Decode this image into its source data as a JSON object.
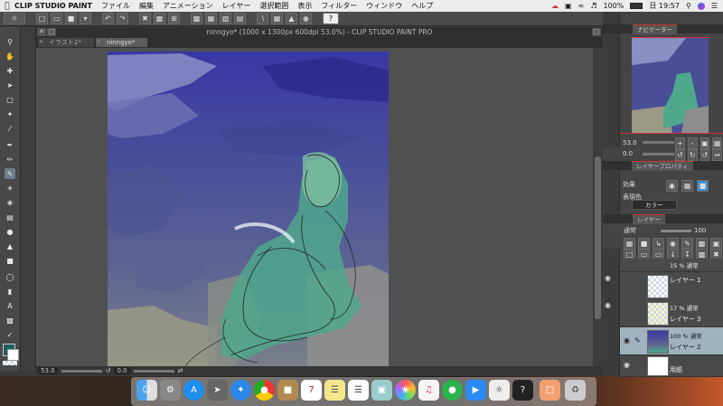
{
  "menubar": {
    "app_name": "CLIP STUDIO PAINT",
    "items": [
      "ファイル",
      "編集",
      "アニメーション",
      "レイヤー",
      "選択範囲",
      "表示",
      "フィルター",
      "ウィンドウ",
      "ヘルプ"
    ],
    "battery": "100%",
    "clock": "日 19:57"
  },
  "window": {
    "title": "ninngyo* (1000 x 1300px 600dpi 53.0%)  - CLIP STUDIO PAINT PRO",
    "tabs": [
      {
        "label": "イラスト2*"
      },
      {
        "label": "ninngyo*"
      }
    ]
  },
  "statusbar": {
    "zoom": "53.0",
    "angle": "0.0"
  },
  "navigator": {
    "tab_label": "ナビゲーター",
    "zoom": "53.0",
    "angle": "0.0"
  },
  "layer_property": {
    "tab_label": "レイヤープロパティ",
    "effect_label": "効果",
    "expression_label": "表現色",
    "expression_value": "カラー"
  },
  "layers_panel": {
    "tab_label": "レイヤー",
    "blend_mode": "通常",
    "opacity": "100",
    "layers": [
      {
        "opacity": "15 % 通常",
        "name": "レイヤー 1"
      },
      {
        "opacity": "17 % 通常",
        "name": "レイヤー 3"
      },
      {
        "opacity": "100 % 通常",
        "name": "レイヤー 2"
      },
      {
        "opacity": "",
        "name": "用紙"
      }
    ]
  },
  "colors": {
    "main_color": "#1f5e5c",
    "sub_color": "#ffffff",
    "canvas_bg": "#505050",
    "accent_red": "#cc3333"
  }
}
